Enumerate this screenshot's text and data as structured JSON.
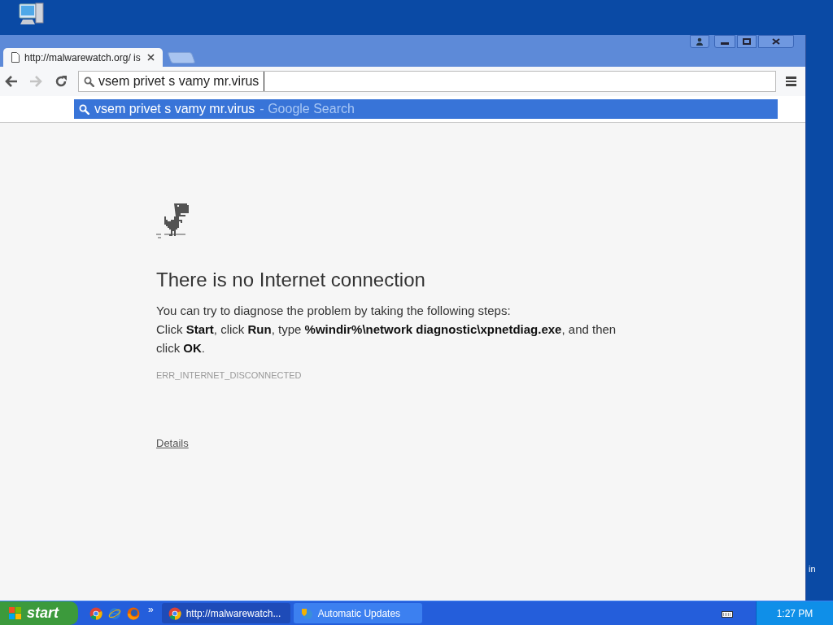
{
  "browser": {
    "tabs": [
      {
        "title": "http://malwarewatch.org/ is",
        "selected": true
      }
    ],
    "nav": {
      "back_disabled": false,
      "forward_disabled": true
    },
    "omnibox": {
      "value": "vsem privet s vamy mr.virus "
    },
    "suggestions": [
      {
        "text": "vsem privet s vamy mr.virus",
        "hint": "- Google Search",
        "selected": true
      }
    ],
    "error": {
      "title": "There is no Internet connection",
      "intro": "You can try to diagnose the problem by taking the following steps:",
      "steps": "Click **Start**, click **Run**, type **%windir%\\network diagnostic\\xpnetdiag.exe**, and then click **OK**.",
      "code": "ERR_INTERNET_DISCONNECTED",
      "details_link": "Details"
    }
  },
  "desktop_text": "in",
  "taskbar": {
    "start": "start",
    "quick_launch": [
      {
        "kind": "chrome"
      },
      {
        "kind": "ie"
      },
      {
        "kind": "firefox"
      }
    ],
    "chevron": "»",
    "tasks": [
      {
        "label": "http://malwarewatch...",
        "kind": "chrome",
        "selected": true
      },
      {
        "label": "Automatic Updates",
        "kind": "updates",
        "selected": false
      }
    ],
    "clock": "1:27 PM"
  }
}
